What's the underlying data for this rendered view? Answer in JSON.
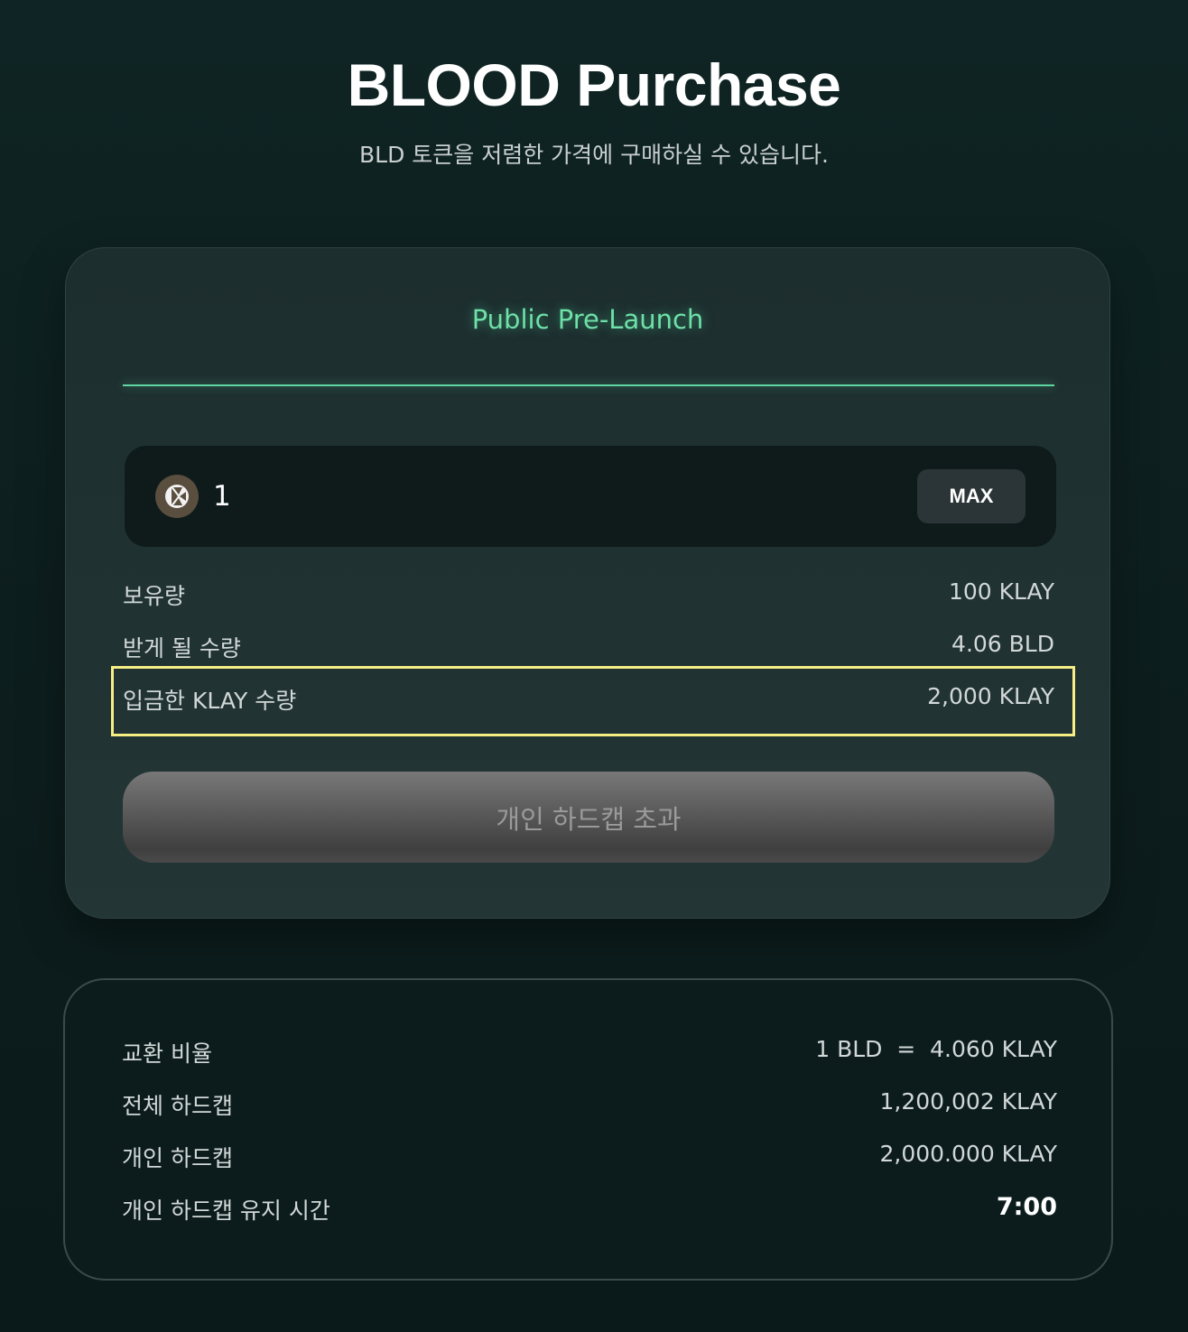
{
  "header": {
    "title": "BLOOD Purchase",
    "subtitle": "BLD 토큰을 저렴한 가격에 구매하실 수 있습니다."
  },
  "purchase_card": {
    "tab_label": "Public Pre-Launch",
    "amount_input_value": "1",
    "token_icon": "klay-token-icon",
    "max_label": "MAX",
    "rows": [
      {
        "label": "보유량",
        "value": "100 KLAY"
      },
      {
        "label": "받게 될 수량",
        "value": "4.06 BLD"
      },
      {
        "label": "입금한 KLAY 수량",
        "value": "2,000 KLAY"
      }
    ],
    "action_label": "개인 하드캡 초과"
  },
  "info_card": {
    "rows": [
      {
        "label": "교환 비율",
        "value": "1 BLD  =  4.060 KLAY"
      },
      {
        "label": "전체 하드캡",
        "value": "1,200,002 KLAY"
      },
      {
        "label": "개인 하드캡",
        "value": "2,000.000 KLAY"
      },
      {
        "label": "개인 하드캡 유지 시간",
        "value": "7:00"
      }
    ]
  },
  "colors": {
    "accent_green": "#6ee0a8",
    "highlight_yellow": "#f7ee86",
    "background": "#0f2424"
  }
}
